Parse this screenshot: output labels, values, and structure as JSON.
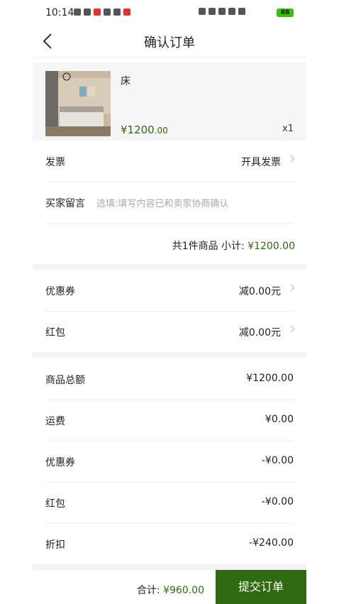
{
  "status_bar": {
    "time": "10:14",
    "battery": "88"
  },
  "header": {
    "title": "确认订单"
  },
  "product": {
    "name": "床",
    "price_main": "¥1200",
    "price_dec": ".00",
    "qty": "x1"
  },
  "invoice": {
    "label": "发票",
    "value": "开具发票"
  },
  "message": {
    "label": "买家留言",
    "placeholder": "选填:填写内容已和卖家协商确认"
  },
  "subtotal": {
    "text": "共1件商品  小计:",
    "amount": "¥1200.00"
  },
  "coupon": {
    "label": "优惠券",
    "value": "减0.00元"
  },
  "redpacket": {
    "label": "红包",
    "value": "减0.00元"
  },
  "summary": [
    {
      "label": "商品总额",
      "value": "¥1200.00"
    },
    {
      "label": "运费",
      "value": "¥0.00"
    },
    {
      "label": "优惠券",
      "value": "-¥0.00"
    },
    {
      "label": "红包",
      "value": "-¥0.00"
    },
    {
      "label": "折扣",
      "value": "-¥240.00"
    }
  ],
  "footer": {
    "total_label": "合计:",
    "total_amount": "¥960.00",
    "submit_label": "提交订单"
  },
  "colors": {
    "accent": "#2d6a10",
    "price": "#2f6b10"
  }
}
